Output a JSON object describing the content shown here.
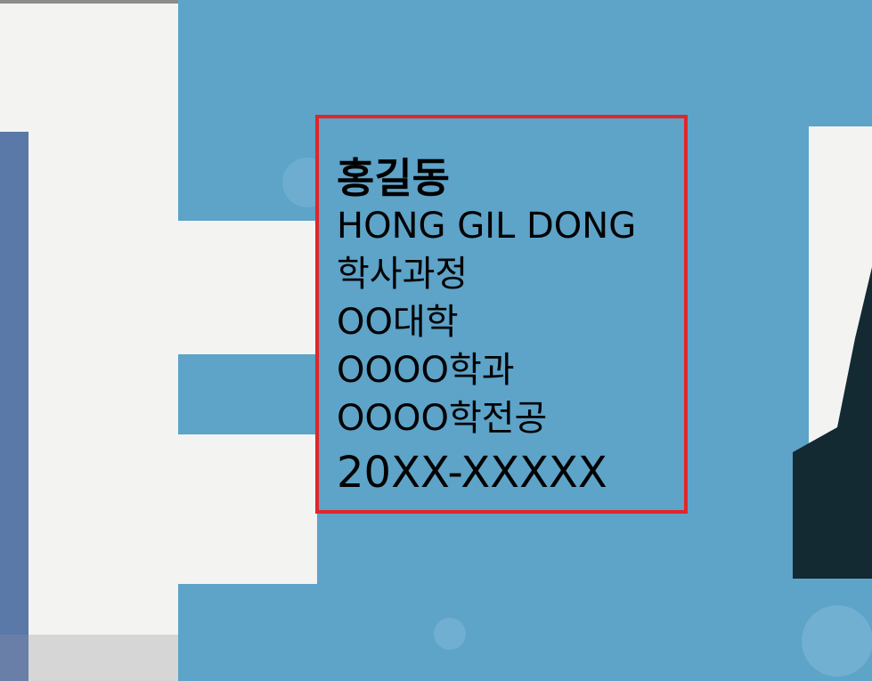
{
  "id_card": {
    "name_korean": "홍길동",
    "name_english": "HONG GIL DONG",
    "degree": "학사과정",
    "university": "OO대학",
    "department": "OOOO학과",
    "major": "OOOO학전공",
    "student_id": "20XX-XXXXX"
  },
  "colors": {
    "card_blue": "#5ea3c8",
    "highlight_border": "#e0262a",
    "background_white": "#f3f3f1",
    "left_strip": "#5a78a8",
    "dark_figure": "#142a32"
  }
}
